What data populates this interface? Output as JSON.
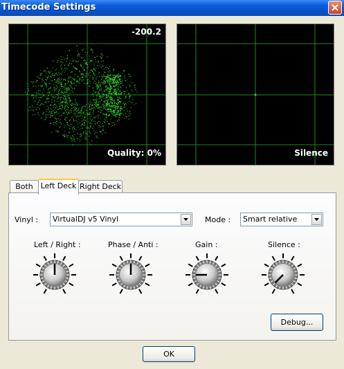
{
  "window": {
    "title": "Timecode Settings"
  },
  "scope_left": {
    "value": "-200.2",
    "quality": "Quality: 0%"
  },
  "scope_right": {
    "status": "Silence"
  },
  "tabs": [
    {
      "label": "Both",
      "active": false
    },
    {
      "label": "Left Deck",
      "active": true
    },
    {
      "label": "Right Deck",
      "active": false
    }
  ],
  "vinyl": {
    "label": "Vinyl :",
    "value": "VirtualDJ v5 Vinyl"
  },
  "mode": {
    "label": "Mode :",
    "value": "Smart relative"
  },
  "knobs": [
    {
      "label": "Left / Right :",
      "angle": 0
    },
    {
      "label": "Phase / Anti :",
      "angle": 0
    },
    {
      "label": "Gain :",
      "angle": -90
    },
    {
      "label": "Silence :",
      "angle": 225
    }
  ],
  "buttons": {
    "debug": "Debug...",
    "ok": "OK"
  },
  "colors": {
    "title_bar": "#0a5ede",
    "scope_bg": "#000000",
    "scope_dots": "#2fd62f",
    "scope_grid": "#1f8a1f"
  }
}
